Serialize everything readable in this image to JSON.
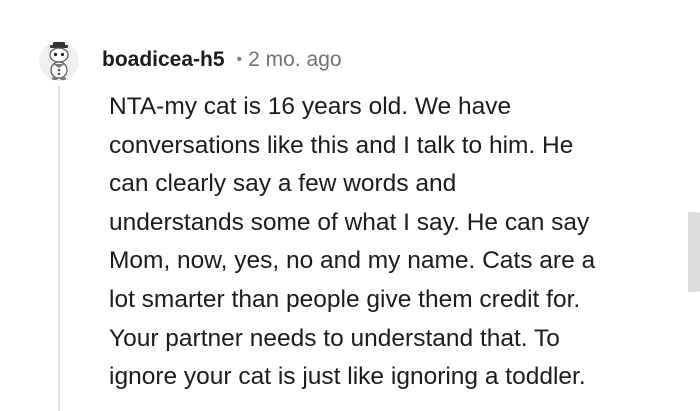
{
  "comment": {
    "avatar_icon": "snoo-avatar-icon",
    "username": "boadicea-h5",
    "separator": "•",
    "timestamp": "2 mo. ago",
    "lines": [
      "NTA-my cat is 16 years old. We have",
      "conversations like this and I talk to him. He",
      "can clearly say a few words and",
      "understands some of what I say. He can say",
      "Mom, now, yes, no and my name. Cats are a",
      "lot smarter than people give them credit for.",
      "Your partner needs to understand that. To",
      "ignore your cat is just like ignoring a toddler."
    ]
  },
  "colors": {
    "text": "#1c1c1c",
    "meta": "#6f7479",
    "thread_line": "#e2e4e6",
    "scrollbar": "#dcdcdc"
  }
}
